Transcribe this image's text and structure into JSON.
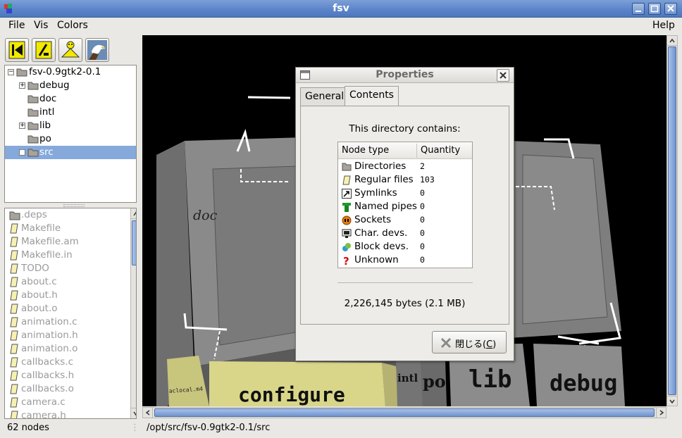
{
  "window": {
    "title": "fsv"
  },
  "menubar": {
    "file": "File",
    "vis": "Vis",
    "colors": "Colors",
    "help": "Help"
  },
  "toolbar": {
    "buttons": [
      "back-to-root-icon",
      "cd-up-icon",
      "birdseye-icon",
      "eagle-view-icon"
    ]
  },
  "dir_tree": {
    "root": "fsv-0.9gtk2-0.1",
    "items": [
      {
        "label": "debug",
        "expandable": true
      },
      {
        "label": "doc",
        "expandable": false
      },
      {
        "label": "intl",
        "expandable": false
      },
      {
        "label": "lib",
        "expandable": true
      },
      {
        "label": "po",
        "expandable": false
      },
      {
        "label": "src",
        "expandable": true,
        "selected": true
      }
    ]
  },
  "file_list": {
    "items": [
      ".deps",
      "Makefile",
      "Makefile.am",
      "Makefile.in",
      "TODO",
      "about.c",
      "about.h",
      "about.o",
      "animation.c",
      "animation.h",
      "animation.o",
      "callbacks.c",
      "callbacks.h",
      "callbacks.o",
      "camera.c",
      "camera.h"
    ]
  },
  "scene": {
    "labels": {
      "doc": "doc",
      "configure": "configure",
      "aclocal": "aclocal.m4",
      "intl": "intl",
      "po": "po",
      "lib": "lib",
      "debug": "debug"
    }
  },
  "statusbar": {
    "nodes": "62 nodes",
    "path": "/opt/src/fsv-0.9gtk2-0.1/src"
  },
  "dialog": {
    "title": "Properties",
    "tabs": [
      "General",
      "Contents"
    ],
    "active_tab": "Contents",
    "heading": "This directory contains:",
    "columns": {
      "type": "Node type",
      "qty": "Quantity"
    },
    "rows": [
      {
        "type": "Directories",
        "qty": "2",
        "icon": "folder-icon"
      },
      {
        "type": "Regular files",
        "qty": "103",
        "icon": "file-icon"
      },
      {
        "type": "Symlinks",
        "qty": "0",
        "icon": "symlink-icon"
      },
      {
        "type": "Named pipes",
        "qty": "0",
        "icon": "pipe-icon"
      },
      {
        "type": "Sockets",
        "qty": "0",
        "icon": "socket-icon"
      },
      {
        "type": "Char. devs.",
        "qty": "0",
        "icon": "char-device-icon"
      },
      {
        "type": "Block devs.",
        "qty": "0",
        "icon": "block-device-icon"
      },
      {
        "type": "Unknown",
        "qty": "0",
        "icon": "unknown-icon"
      }
    ],
    "total": "2,226,145 bytes (2.1 MB)",
    "close_label": "閉じる(",
    "close_mnemonic": "C",
    "close_tail": ")"
  },
  "colors": {
    "titlebar": "#5a83c8",
    "selection": "#86a9db",
    "viewport_bg": "#000000",
    "gold": "#d9d68a"
  }
}
